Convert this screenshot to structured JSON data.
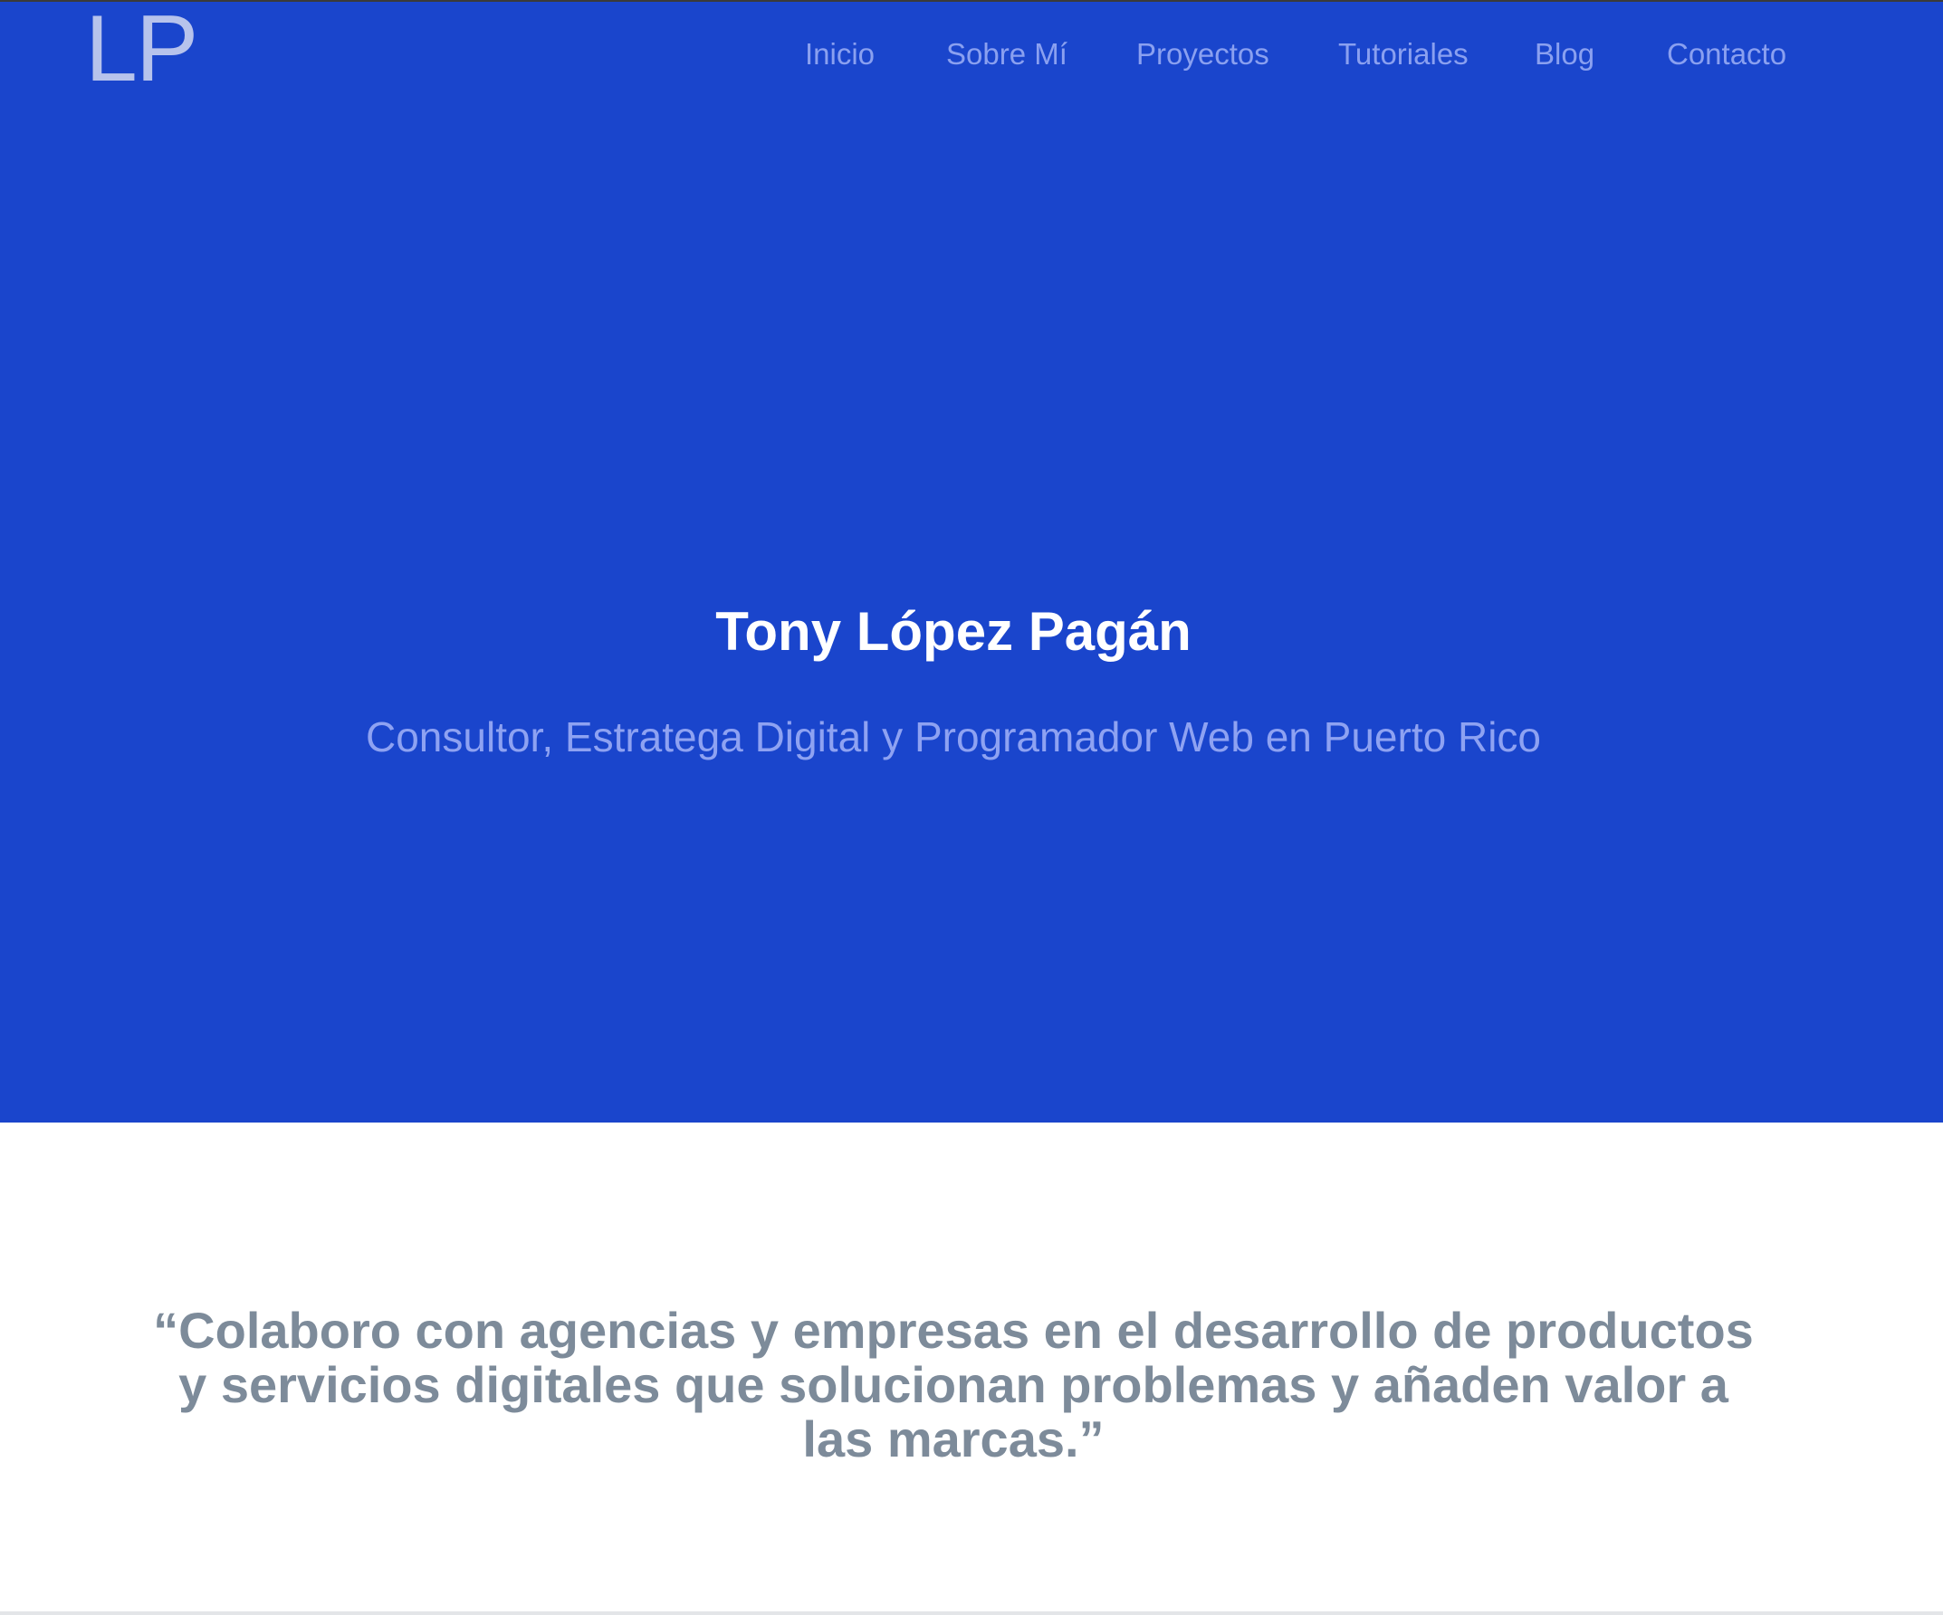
{
  "header": {
    "logo": "LP",
    "nav": [
      {
        "label": "Inicio"
      },
      {
        "label": "Sobre Mí"
      },
      {
        "label": "Proyectos"
      },
      {
        "label": "Tutoriales"
      },
      {
        "label": "Blog"
      },
      {
        "label": "Contacto"
      }
    ]
  },
  "hero": {
    "title": "Tony López Pagán",
    "subtitle": "Consultor, Estratega Digital y Programador Web en Puerto Rico"
  },
  "quote": {
    "text": "“Colaboro con agencias y empresas en el desarrollo de productos y servicios digitales que solucionan problemas y añaden valor a las marcas.”"
  },
  "colors": {
    "hero_background": "#1a45cc",
    "nav_link": "#8aa0f0",
    "quote_text": "#7d8b9a"
  }
}
